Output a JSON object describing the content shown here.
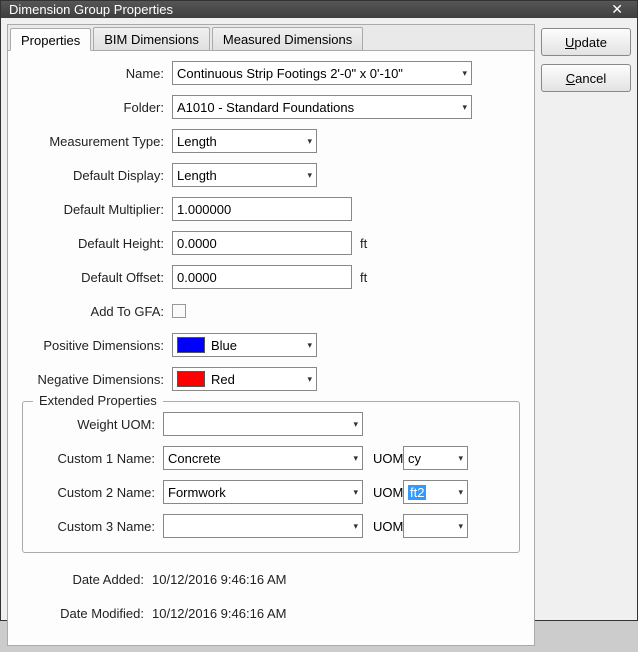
{
  "title": "Dimension Group Properties",
  "tabs": {
    "props": "Properties",
    "bim": "BIM Dimensions",
    "measured": "Measured Dimensions"
  },
  "labels": {
    "name": "Name:",
    "folder": "Folder:",
    "measType": "Measurement Type:",
    "defDisplay": "Default Display:",
    "defMult": "Default Multiplier:",
    "defHeight": "Default Height:",
    "defOffset": "Default Offset:",
    "addGFA": "Add To GFA:",
    "posDim": "Positive Dimensions:",
    "negDim": "Negative Dimensions:",
    "ft": "ft",
    "extended": "Extended Properties",
    "weightUOM": "Weight UOM:",
    "c1name": "Custom 1 Name:",
    "c2name": "Custom 2 Name:",
    "c3name": "Custom 3 Name:",
    "uom": "UOM:",
    "dateAdded": "Date Added:",
    "dateModified": "Date Modified:"
  },
  "values": {
    "name": "Continuous Strip Footings 2'-0\" x 0'-10\"",
    "folder": "A1010 - Standard Foundations",
    "measType": "Length",
    "defDisplay": "Length",
    "defMult": "1.000000",
    "defHeight": "0.0000",
    "defOffset": "0.0000",
    "posDim": "Blue",
    "negDim": "Red",
    "weightUOM": "",
    "c1name": "Concrete",
    "c1uom": "cy",
    "c2name": "Formwork",
    "c2uom": "ft2",
    "c3name": "",
    "c3uom": "",
    "dateAdded": "10/12/2016 9:46:16 AM",
    "dateModified": "10/12/2016 9:46:16 AM"
  },
  "buttons": {
    "update": "pdate",
    "updatePrefix": "U",
    "cancel": "ancel",
    "cancelPrefix": "C"
  }
}
